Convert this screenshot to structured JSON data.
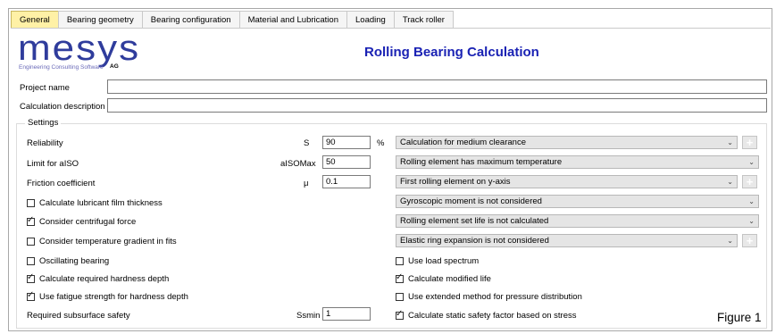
{
  "tabs": [
    "General",
    "Bearing geometry",
    "Bearing configuration",
    "Material and Lubrication",
    "Loading",
    "Track roller"
  ],
  "active_tab": "General",
  "logo": {
    "word": "mesys",
    "subtitle": "Engineering Consulting Software",
    "suffix": "AG"
  },
  "app_title": "Rolling Bearing Calculation",
  "project": {
    "name_label": "Project name",
    "name_value": "",
    "desc_label": "Calculation description",
    "desc_value": ""
  },
  "settings": {
    "title": "Settings",
    "reliability": {
      "label": "Reliability",
      "symbol": "S",
      "value": "90",
      "unit": "%"
    },
    "limit": {
      "label": "Limit for aISO",
      "symbol": "aISOMax",
      "value": "50"
    },
    "friction": {
      "label": "Friction coefficient",
      "symbol": "μ",
      "value": "0.1"
    },
    "subsurface": {
      "label": "Required subsurface safety",
      "symbol": "Ssmin",
      "value": "1"
    },
    "left_checks": [
      {
        "label": "Calculate lubricant film thickness",
        "checked": false
      },
      {
        "label": "Consider centrifugal force",
        "checked": true
      },
      {
        "label": "Consider temperature gradient in fits",
        "checked": false
      },
      {
        "label": "Oscillating bearing",
        "checked": false
      },
      {
        "label": "Calculate required hardness depth",
        "checked": true
      },
      {
        "label": "Use fatigue strength for hardness depth",
        "checked": true
      }
    ],
    "combos": [
      "Calculation for medium clearance",
      "Rolling element has maximum temperature",
      "First rolling element on y-axis",
      "Gyroscopic moment is not considered",
      "Rolling element set life is not calculated",
      "Elastic ring expansion is not considered"
    ],
    "right_checks": [
      {
        "label": "Use load spectrum",
        "checked": false
      },
      {
        "label": "Calculate modified life",
        "checked": true
      },
      {
        "label": "Use extended method for pressure distribution",
        "checked": false
      },
      {
        "label": "Calculate static safety factor based on stress",
        "checked": true
      }
    ],
    "plus_symbol": "+",
    "check_mark": "✓",
    "arrow_symbol": "⌄"
  },
  "figure_label": "Figure 1",
  "colors": {
    "title_blue": "#1a22b4",
    "logo_blue": "#2f3c9c",
    "active_tab": "#fff1a6"
  }
}
